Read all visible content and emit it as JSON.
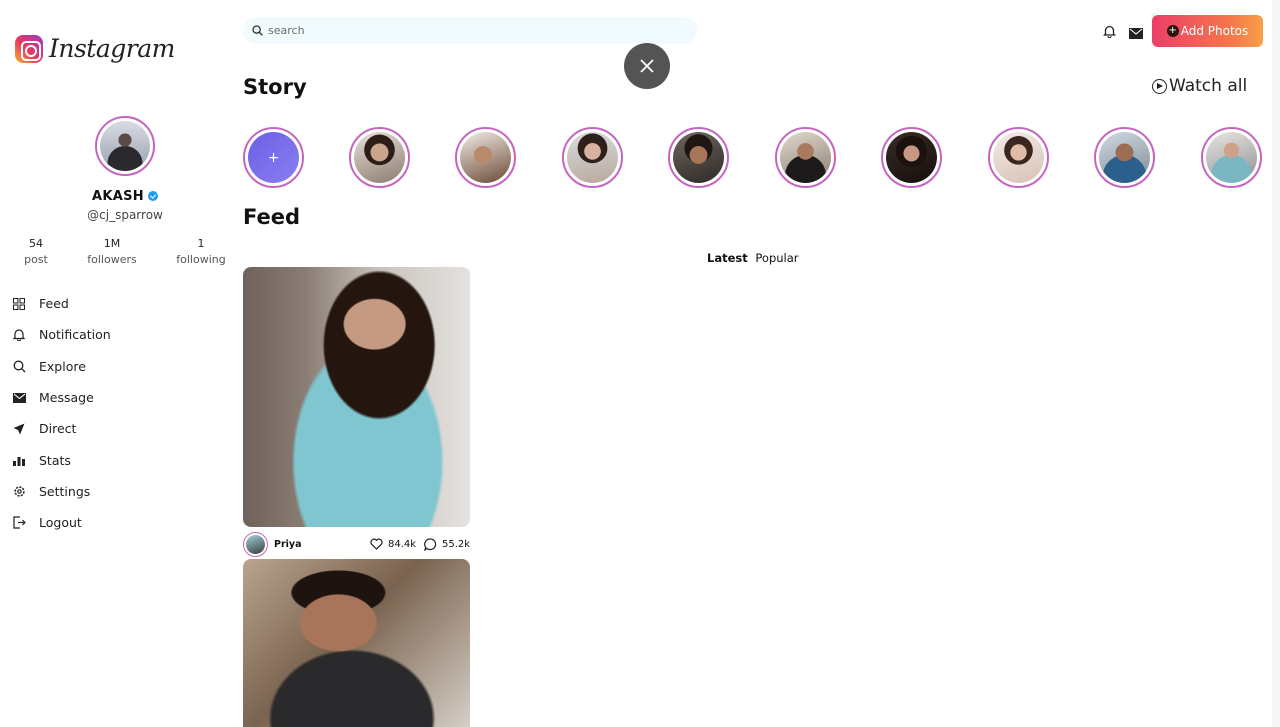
{
  "brand": {
    "name": "Instagram"
  },
  "profile": {
    "name": "AKASH",
    "handle": "@cj_sparrow",
    "stats": [
      {
        "value": "54",
        "label": "post"
      },
      {
        "value": "1M",
        "label": "followers"
      },
      {
        "value": "1",
        "label": "following"
      }
    ]
  },
  "nav": [
    {
      "label": "Feed",
      "icon": "grid-icon"
    },
    {
      "label": "Notification",
      "icon": "bell-icon"
    },
    {
      "label": "Explore",
      "icon": "search-icon"
    },
    {
      "label": "Message",
      "icon": "envelope-icon"
    },
    {
      "label": "Direct",
      "icon": "send-icon"
    },
    {
      "label": "Stats",
      "icon": "bar-chart-icon"
    },
    {
      "label": "Settings",
      "icon": "gear-icon"
    },
    {
      "label": "Logout",
      "icon": "logout-icon"
    }
  ],
  "search": {
    "placeholder": "search"
  },
  "header": {
    "add_photos": "Add Photos"
  },
  "story": {
    "title": "Story",
    "watch_all": "Watch all"
  },
  "feed": {
    "title": "Feed",
    "tabs": [
      {
        "label": "Latest",
        "active": true
      },
      {
        "label": "Popular",
        "active": false
      }
    ],
    "posts": [
      {
        "user": "Priya",
        "likes": "84.4k",
        "comments": "55.2k"
      }
    ]
  },
  "colors": {
    "accent_gradient_start": "#ec3e69",
    "accent_gradient_end": "#f8a04a",
    "story_ring": "#c466c0",
    "verified": "#1d9bf0"
  }
}
